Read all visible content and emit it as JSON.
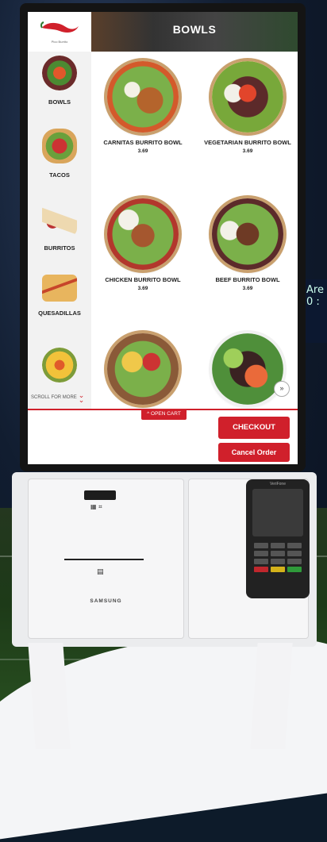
{
  "header": {
    "logo_text": "Pico Burrito",
    "title": "BOWLS"
  },
  "sidebar": {
    "items": [
      {
        "label": "BOWLS",
        "icon": "bowl-icon"
      },
      {
        "label": "TACOS",
        "icon": "tacos-icon"
      },
      {
        "label": "BURRITOS",
        "icon": "burrito-icon"
      },
      {
        "label": "QUESADILLAS",
        "icon": "quesadilla-icon"
      },
      {
        "label": "",
        "icon": "nachos-icon"
      }
    ],
    "scroll_more": "SCROLL FOR MORE"
  },
  "menu": {
    "items": [
      {
        "name": "CARNITAS BURRITO BOWL",
        "price": "3.69"
      },
      {
        "name": "VEGETARIAN BURRITO BOWL",
        "price": "3.69"
      },
      {
        "name": "CHICKEN BURRITO BOWL",
        "price": "3.69"
      },
      {
        "name": "BEEF BURRITO BOWL",
        "price": "3.69"
      },
      {
        "name": "",
        "price": ""
      },
      {
        "name": "",
        "price": ""
      }
    ]
  },
  "cart": {
    "open_cart": "^ OPEN CART",
    "checkout": "CHECKOUT",
    "cancel": "Cancel Order"
  },
  "hardware": {
    "brand": "SAMSUNG",
    "terminal_brand": "VeriFone"
  },
  "colors": {
    "accent": "#d0202b"
  }
}
